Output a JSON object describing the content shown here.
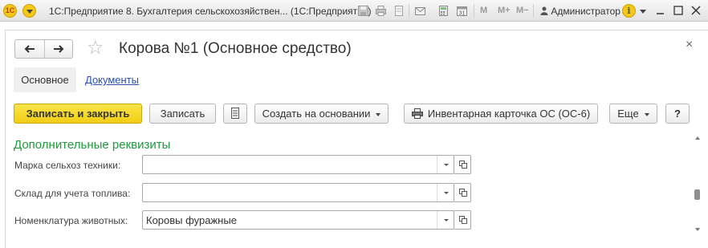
{
  "titlebar": {
    "title": "1С:Предприятие 8. Бухгалтерия сельскохозяйствен... (1С:Предприятие)",
    "logo_text": "1С",
    "m_label": "M",
    "m_plus_label": "M+",
    "m_minus_label": "M−",
    "user_name": "Администратор",
    "info_label": "i"
  },
  "form": {
    "title": "Корова №1 (Основное средство)",
    "tabs": [
      {
        "label": "Основное",
        "active": true
      },
      {
        "label": "Документы",
        "active": false
      }
    ],
    "toolbar": {
      "save_close": "Записать и закрыть",
      "save": "Записать",
      "create_based": "Создать на основании",
      "inventory_card": "Инвентарная карточка ОС (ОС-6)",
      "more": "Еще",
      "help": "?"
    },
    "section_title": "Дополнительные реквизиты",
    "fields": [
      {
        "label": "Марка сельхоз техники:",
        "value": ""
      },
      {
        "label": "Склад для учета топлива:",
        "value": ""
      },
      {
        "label": "Номенклатура животных:",
        "value": "Коровы фуражные"
      }
    ]
  },
  "colors": {
    "accent_button": "#f1ce14",
    "section_title": "#1e9a3c",
    "link": "#2b4eb0"
  }
}
